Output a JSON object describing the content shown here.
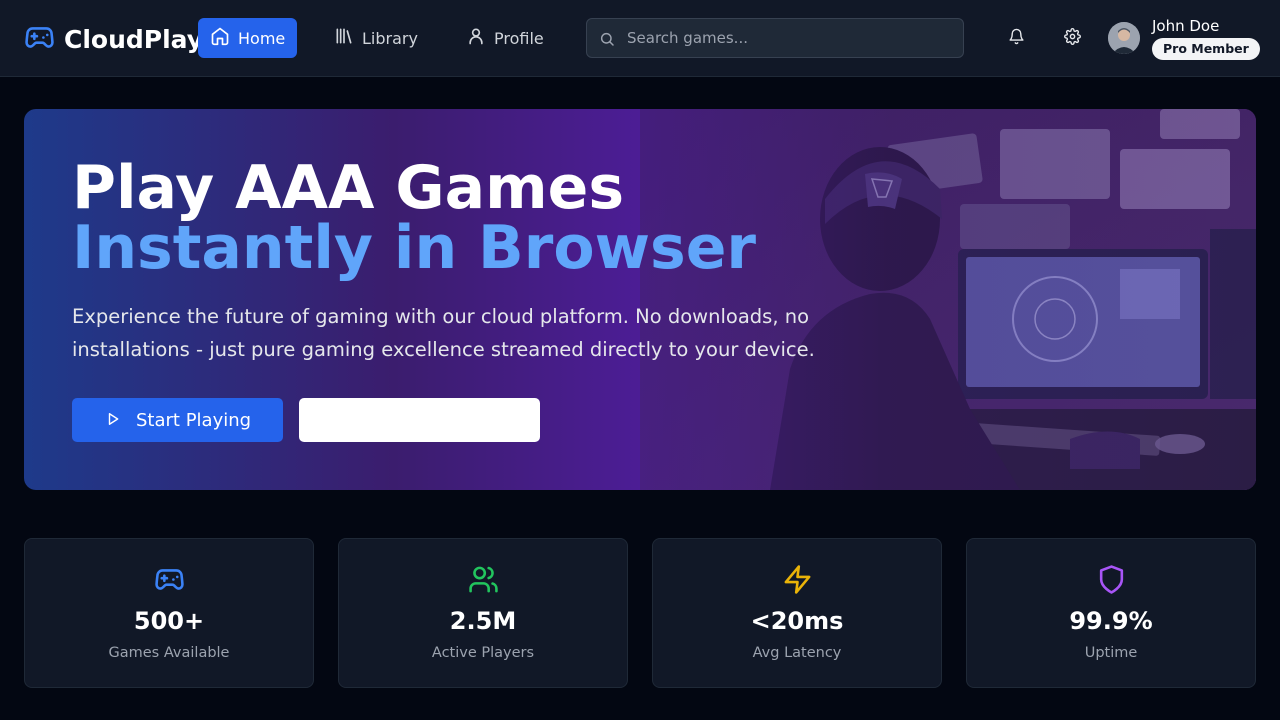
{
  "app": {
    "name": "CloudPlay"
  },
  "nav": [
    {
      "label": "Home",
      "icon": "home-icon",
      "active": true
    },
    {
      "label": "Library",
      "icon": "library-icon",
      "active": false
    },
    {
      "label": "Profile",
      "icon": "user-icon",
      "active": false
    }
  ],
  "search": {
    "placeholder": "Search games...",
    "value": ""
  },
  "user": {
    "name": "John Doe",
    "badge": "Pro Member"
  },
  "hero": {
    "title_line1": "Play AAA Games",
    "title_line2": "Instantly in Browser",
    "description": "Experience the future of gaming with our cloud platform. No downloads, no installations - just pure gaming excellence streamed directly to your device.",
    "primary_button": "Start Playing",
    "secondary_button": ""
  },
  "stats": [
    {
      "value": "500+",
      "label": "Games Available",
      "icon": "gamepad-icon",
      "color": "#3b82f6"
    },
    {
      "value": "2.5M",
      "label": "Active Players",
      "icon": "users-icon",
      "color": "#22c55e"
    },
    {
      "value": "<20ms",
      "label": "Avg Latency",
      "icon": "zap-icon",
      "color": "#eab308"
    },
    {
      "value": "99.9%",
      "label": "Uptime",
      "icon": "shield-icon",
      "color": "#a855f7"
    }
  ],
  "colors": {
    "accent": "#2563eb",
    "accent_light": "#60a5fa",
    "background": "#030712",
    "surface": "#111827"
  }
}
